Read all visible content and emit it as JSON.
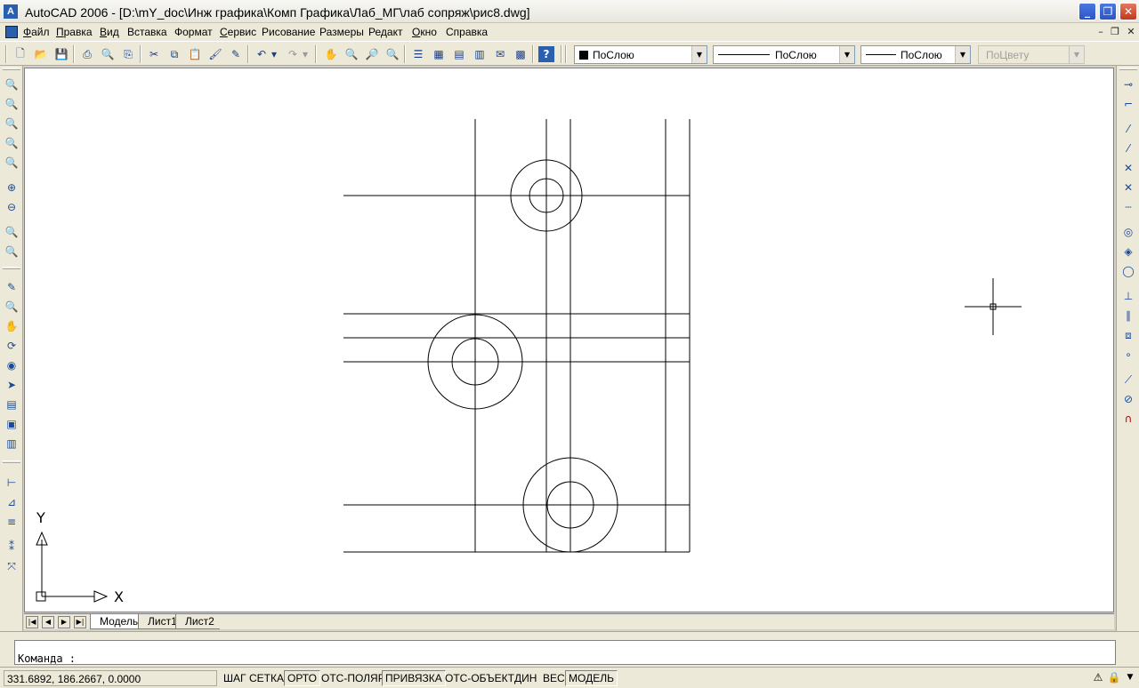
{
  "window": {
    "title": "AutoCAD 2006 - [D:\\mY_doc\\Инж графика\\Комп Графика\\Лаб_МГ\\лаб сопряж\\рис8.dwg]",
    "logo": "A"
  },
  "menu": {
    "items": [
      {
        "first": "Ф",
        "rest": "айл"
      },
      {
        "first": "П",
        "rest": "равка"
      },
      {
        "first": "В",
        "rest": "ид"
      },
      {
        "first": "",
        "rest": "Вставка"
      },
      {
        "first": "",
        "rest": "Формат"
      },
      {
        "first": "С",
        "rest": "ервис"
      },
      {
        "first": "",
        "rest": "Рисование"
      },
      {
        "first": "",
        "rest": "Размеры"
      },
      {
        "first": "",
        "rest": "Редакт"
      },
      {
        "first": "О",
        "rest": "кно"
      },
      {
        "first": "",
        "rest": "Справка"
      }
    ]
  },
  "toolbar": {
    "layer_combo": "ПоСлою",
    "linetype_combo": "ПоСлою",
    "lineweight_combo": "ПоСлою",
    "color_combo": "ПоЦвету"
  },
  "ucs": {
    "x_label": "X",
    "y_label": "Y"
  },
  "tabs": {
    "items": [
      "Модель",
      "Лист1",
      "Лист2"
    ],
    "active": "Модель"
  },
  "command": {
    "prompt": "Команда :"
  },
  "status": {
    "coords": "331.6892, 186.2667, 0.0000",
    "buttons": [
      {
        "label": "ШАГ",
        "on": false
      },
      {
        "label": "СЕТКА",
        "on": false
      },
      {
        "label": "ОРТО",
        "on": true
      },
      {
        "label": "ОТС-ПОЛЯР",
        "on": false
      },
      {
        "label": "ПРИВЯЗКА",
        "on": true
      },
      {
        "label": "ОТС-ОБЪЕКТ",
        "on": false
      },
      {
        "label": "ДИН",
        "on": false
      },
      {
        "label": "ВЕС",
        "on": false
      },
      {
        "label": "МОДЕЛЬ",
        "on": true
      }
    ]
  },
  "colors": {
    "accent": "#2a55c8",
    "close": "#c4381c",
    "panel": "#ece9d8"
  }
}
